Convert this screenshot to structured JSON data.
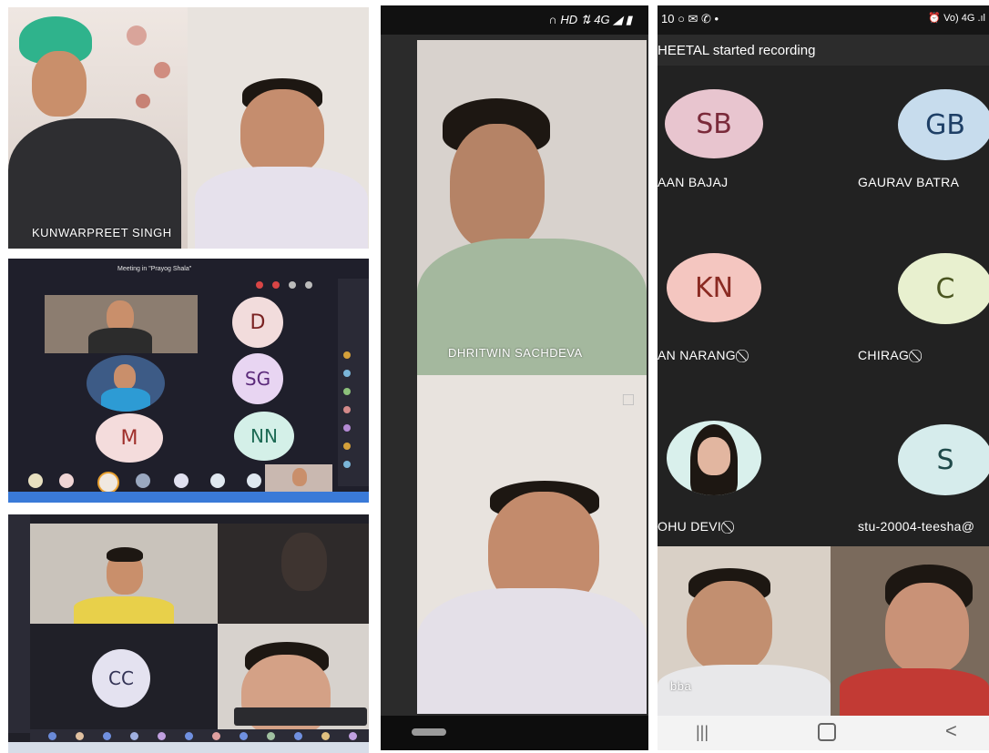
{
  "panel1": {
    "name": "KUNWARPREET SINGH"
  },
  "panel2": {
    "title": "Meeting in \"Prayog Shala\"",
    "avatars": [
      {
        "initials": "D"
      },
      {
        "initials": "SG"
      },
      {
        "initials": "M"
      },
      {
        "initials": "NN"
      }
    ]
  },
  "panel3": {
    "avatar": "CC"
  },
  "phone1": {
    "status_icons": "∩ HD ⇅ 4G ◢ ▮",
    "top_name": "DHRITWIN SACHDEVA"
  },
  "phone2": {
    "status_left": "10 ○ ✉ ✆ •",
    "status_right": "⏰ Vo) 4G .ıl",
    "banner": "HEETAL started recording",
    "tiles": [
      {
        "initials": "SB",
        "name": "AAN BAJAJ",
        "bg": "#e8c5cf",
        "fg": "#7a2a3a",
        "muted": false
      },
      {
        "initials": "GB",
        "name": "GAURAV BATRA",
        "bg": "#c7dced",
        "fg": "#1e3f66",
        "muted": false
      },
      {
        "initials": "KN",
        "name": "AN NARANG",
        "bg": "#f4c6c0",
        "fg": "#8a2a22",
        "muted": true
      },
      {
        "initials": "C",
        "name": "CHIRAG",
        "bg": "#e8f0cf",
        "fg": "#4a5520",
        "muted": true
      },
      {
        "initials": "",
        "name": "OHU DEVI",
        "bg": "#d9f0ec",
        "fg": "#333333",
        "muted": true
      },
      {
        "initials": "S",
        "name": "stu-20004-teesha@",
        "bg": "#d6ecec",
        "fg": "#1f4a4a",
        "muted": false
      }
    ],
    "bottom_label": "bba",
    "mute_icon": "⃠"
  }
}
